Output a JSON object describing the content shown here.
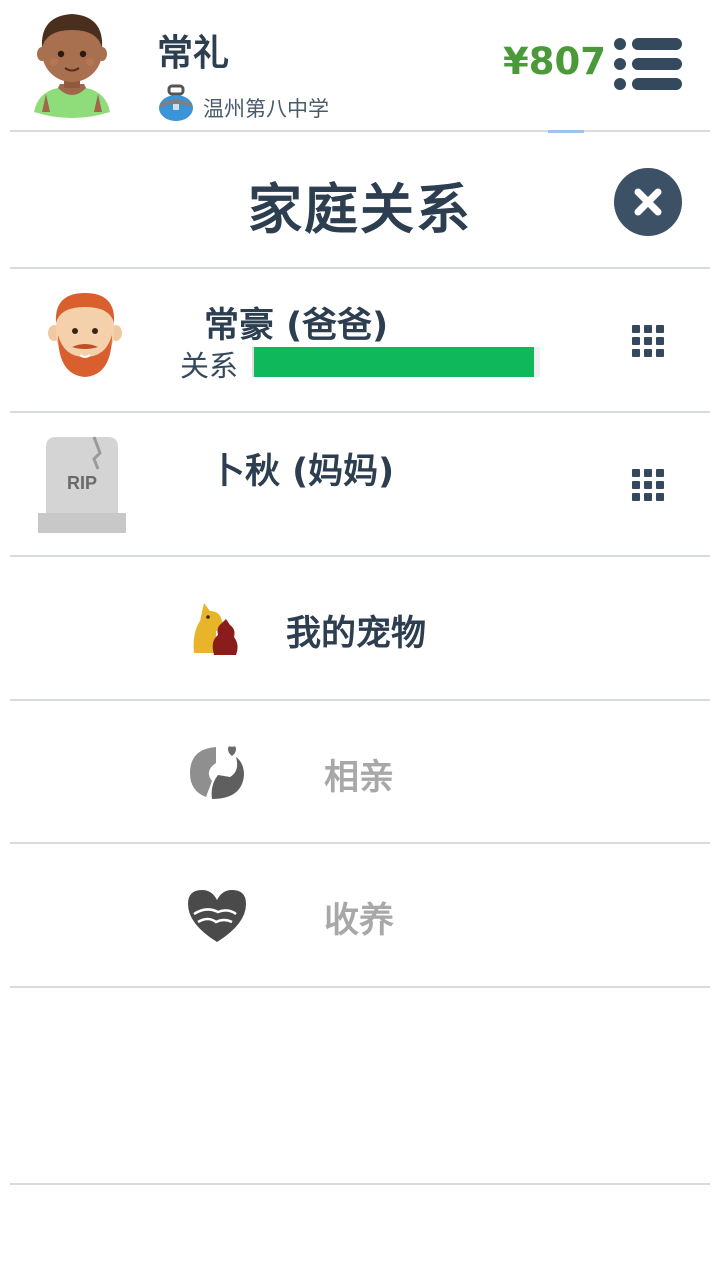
{
  "header": {
    "user_name": "常礼",
    "school": "温州第八中学",
    "money": "¥807",
    "avatar_icon": "boy-avatar-icon",
    "school_icon": "school-bag-icon",
    "menu_icon": "menu-list-icon"
  },
  "panel": {
    "title": "家庭关系",
    "close_icon": "close-icon"
  },
  "family": [
    {
      "name": "常豪 (爸爸)",
      "icon": "bearded-man-icon",
      "relation_label": "关系",
      "relation_level": 0.98,
      "bar_color": "#0fb85a",
      "deceased": false
    },
    {
      "name": "卜秋 (妈妈)",
      "icon": "rip-tombstone-icon",
      "tombstone_text": "RIP",
      "deceased": true
    }
  ],
  "menu": [
    {
      "label": "我的宠物",
      "icon": "pets-icon",
      "enabled": true
    },
    {
      "label": "相亲",
      "icon": "dating-icon",
      "enabled": false
    },
    {
      "label": "收养",
      "icon": "adoption-heart-icon",
      "enabled": false
    }
  ],
  "colors": {
    "text_dark": "#2c3e50",
    "money_green": "#4a9a3a",
    "disabled_gray": "#a8a8a8",
    "close_bg": "#3d5166"
  }
}
